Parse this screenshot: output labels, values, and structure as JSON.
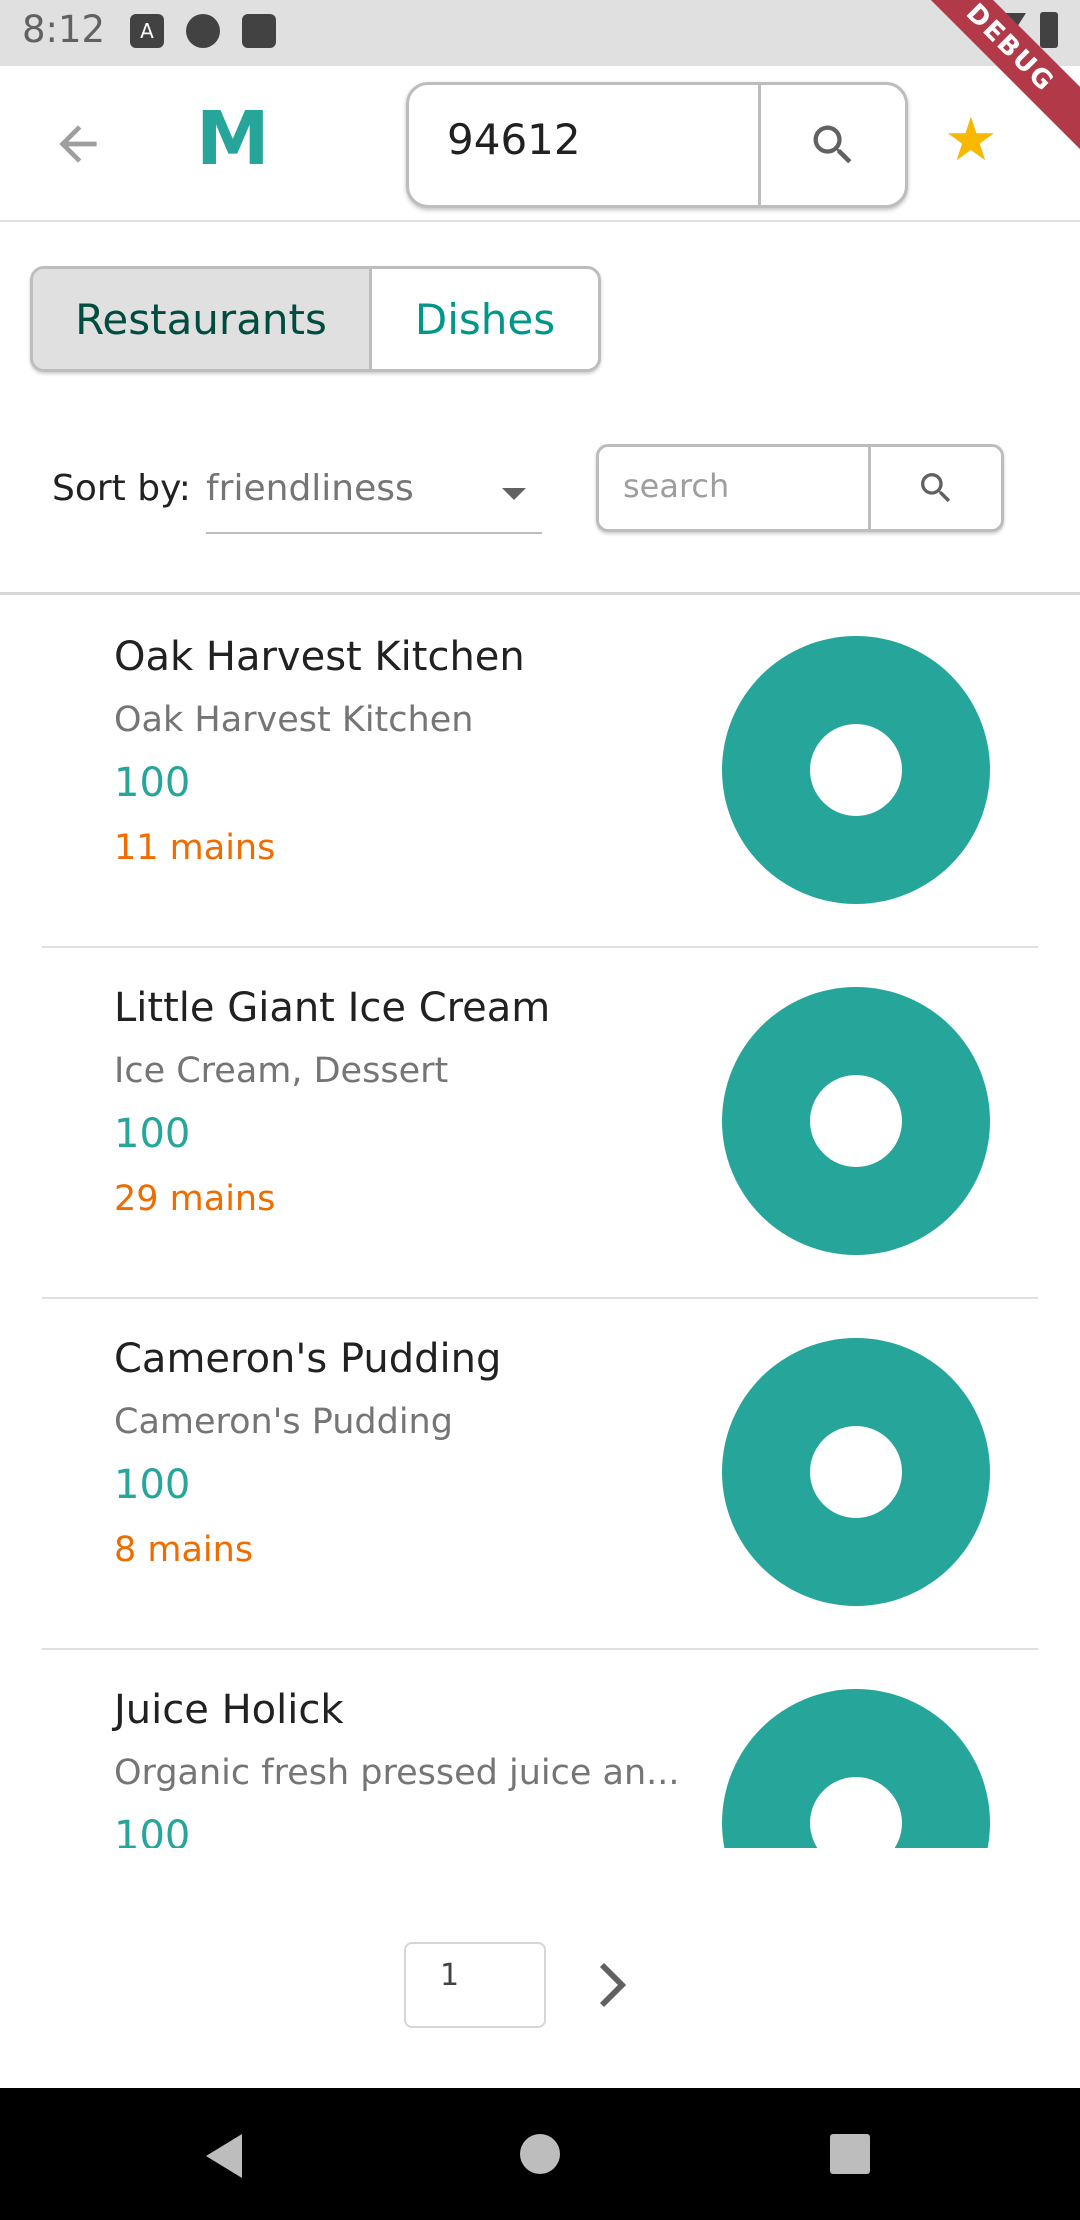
{
  "status_bar": {
    "time": "8:12",
    "debug_label": "DEBUG"
  },
  "app_bar": {
    "logo": "M",
    "zip_value": "94612"
  },
  "tabs": [
    {
      "label": "Restaurants"
    },
    {
      "label": "Dishes"
    }
  ],
  "sort": {
    "label": "Sort by:",
    "value": "friendliness"
  },
  "search": {
    "placeholder": "search"
  },
  "restaurants": [
    {
      "name": "Oak Harvest Kitchen",
      "subtitle": "Oak Harvest Kitchen",
      "score": "100",
      "mains": "11 mains"
    },
    {
      "name": "Little Giant Ice Cream",
      "subtitle": "Ice Cream, Dessert",
      "score": "100",
      "mains": "29 mains"
    },
    {
      "name": "Cameron's Pudding",
      "subtitle": "Cameron's Pudding",
      "score": "100",
      "mains": "8 mains"
    },
    {
      "name": "Juice Holick",
      "subtitle": "Organic fresh pressed juice an...",
      "score": "100",
      "mains": ""
    }
  ],
  "pagination": {
    "page": "1"
  },
  "colors": {
    "accent": "#26a69a",
    "orange": "#ef6c00",
    "star": "#f9b800"
  }
}
